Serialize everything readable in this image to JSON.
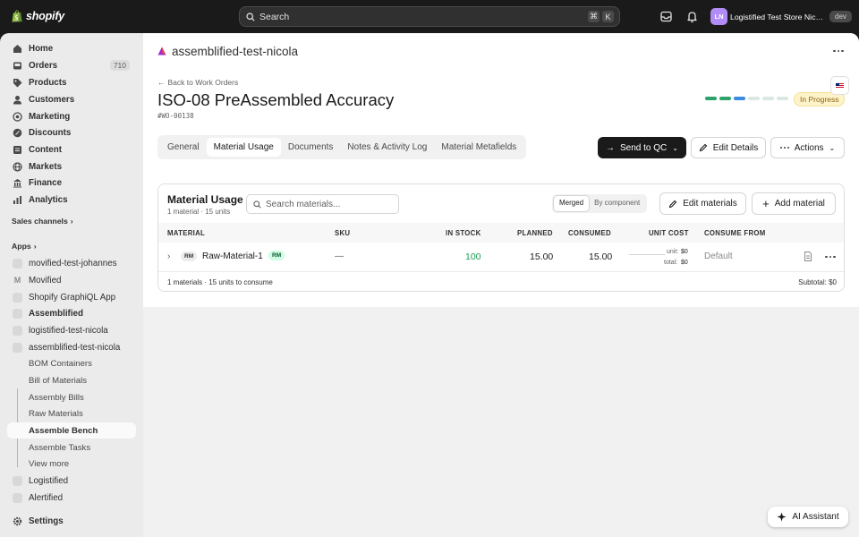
{
  "topbar": {
    "brand": "shopify",
    "search_placeholder": "Search",
    "shortcut": [
      "⌘",
      "K"
    ],
    "store_initials": "LN",
    "store_name": "Logistified Test Store Nicola",
    "store_badge": "dev"
  },
  "sidebar": {
    "nav": [
      {
        "label": "Home",
        "icon": "home-icon"
      },
      {
        "label": "Orders",
        "icon": "inbox-icon",
        "badge": "710"
      },
      {
        "label": "Products",
        "icon": "tag-icon"
      },
      {
        "label": "Customers",
        "icon": "person-icon"
      },
      {
        "label": "Marketing",
        "icon": "target-icon"
      },
      {
        "label": "Discounts",
        "icon": "discount-icon"
      },
      {
        "label": "Content",
        "icon": "content-icon"
      },
      {
        "label": "Markets",
        "icon": "globe-icon"
      },
      {
        "label": "Finance",
        "icon": "bank-icon"
      },
      {
        "label": "Analytics",
        "icon": "chart-icon"
      }
    ],
    "sales_channels_label": "Sales channels",
    "apps_label": "Apps",
    "apps": [
      {
        "label": "movified-test-johannes",
        "icon": "movified-icon"
      },
      {
        "label": "Movified",
        "icon": "movified-logo-icon"
      },
      {
        "label": "Shopify GraphiQL App",
        "icon": "graphiql-icon"
      },
      {
        "label": "Assemblified",
        "icon": "assemblified-icon"
      },
      {
        "label": "logistified-test-nicola",
        "icon": "logistified-icon"
      },
      {
        "label": "assemblified-test-nicola",
        "icon": "assemblified-test-icon"
      }
    ],
    "subitems": [
      "BOM Containers",
      "Bill of Materials",
      "Assembly Bills",
      "Raw Materials",
      "Assemble Bench",
      "Assemble Tasks",
      "View more"
    ],
    "bottom_apps": [
      {
        "label": "Logistified",
        "icon": "logistified-logo-icon"
      },
      {
        "label": "Alertified",
        "icon": "alertified-icon"
      }
    ],
    "settings_label": "Settings"
  },
  "app": {
    "title": "assemblified-test-nicola",
    "back_label": "Back to Work Orders",
    "wo_title": "ISO-08 PreAssembled Accuracy",
    "wo_id": "#WO-00138",
    "status": "In Progress",
    "progress_steps": 6,
    "progress_done": 3,
    "tabs": [
      "General",
      "Material Usage",
      "Documents",
      "Notes & Activity Log",
      "Material Metafields"
    ],
    "active_tab": "Material Usage",
    "send_qc_label": "Send to QC",
    "edit_details_label": "Edit Details",
    "actions_label": "Actions",
    "material_usage": {
      "title": "Material Usage",
      "subtitle": "1 material · 15 units",
      "search_placeholder": "Search materials...",
      "view_merged": "Merged",
      "view_component": "By component",
      "edit_materials_label": "Edit materials",
      "add_material_label": "Add material",
      "columns": [
        "MATERIAL",
        "SKU",
        "IN STOCK",
        "PLANNED",
        "CONSUMED",
        "UNIT COST",
        "CONSUME FROM"
      ],
      "rows": [
        {
          "type_badge": "RM",
          "name": "Raw-Material-1",
          "tag": "RM",
          "sku": "—",
          "in_stock": "100",
          "planned": "15.00",
          "consumed": "15.00",
          "unit_cost_label": "unit:",
          "unit_cost_value": "$0",
          "total_cost_label": "total:",
          "total_cost_value": "$0",
          "consume_from": "Default"
        }
      ],
      "footer_left": "1 materials · 15 units to consume",
      "footer_right": "Subtotal: $0"
    }
  },
  "ai_assistant_label": "AI Assistant",
  "colors": {
    "progress_done": "#2ca36b",
    "progress_active": "#3b8be0",
    "progress_pending": "#d9e8e0",
    "in_stock": "#1a9b52",
    "status_bg": "#fff4c9"
  }
}
